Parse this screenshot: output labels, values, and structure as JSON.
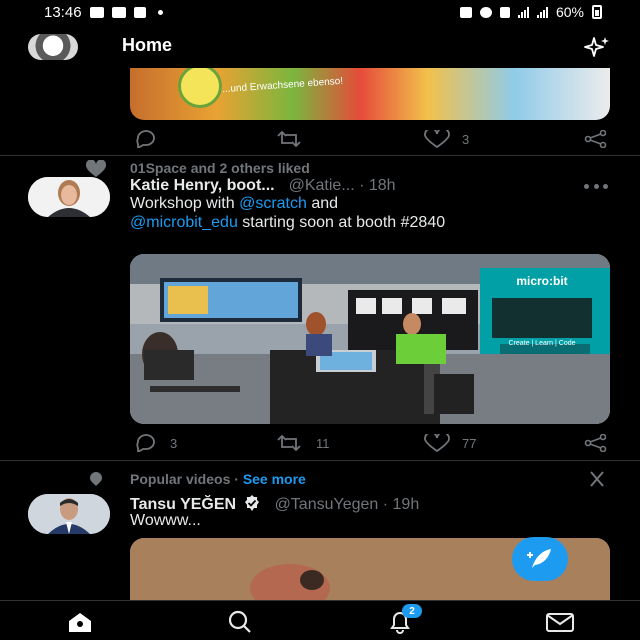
{
  "status_bar": {
    "time": "13:46",
    "battery": "60%"
  },
  "header": {
    "title": "Home",
    "avatar": "profile-avatar",
    "right_icon": "sparkle-icon"
  },
  "top_tweet": {
    "image_text": "...und Erwachsene ebenso!",
    "replies": "",
    "retweets": "",
    "likes": "3"
  },
  "tweet1": {
    "social_context": "01Space and 2 others liked",
    "name": "Katie Henry, boot...",
    "handle": "@Katie...",
    "time": "· 18h",
    "text_prefix": "Workshop with ",
    "mention1": "@scratch",
    "text_mid": " and",
    "mention2": "@microbit_edu",
    "text_suffix": " starting soon at booth #2840",
    "media_sign": "micro:bit",
    "media_sign_sub": "Create | Learn | Code",
    "replies": "3",
    "retweets": "11",
    "likes": "77"
  },
  "popular": {
    "label": "Popular videos",
    "separator": " · ",
    "see_more": "See more"
  },
  "tweet2": {
    "name": "Tansu YEĞEN",
    "handle": "@TansuYegen",
    "time": "· 19h",
    "text": "Wowww..."
  },
  "nav": {
    "items": [
      "home-icon",
      "search-icon",
      "notifications-icon",
      "messages-icon"
    ],
    "notification_count": "2"
  },
  "colors": {
    "accent": "#1d9bf0",
    "muted": "#71767b",
    "text": "#e7e9ea",
    "background": "#000000"
  }
}
